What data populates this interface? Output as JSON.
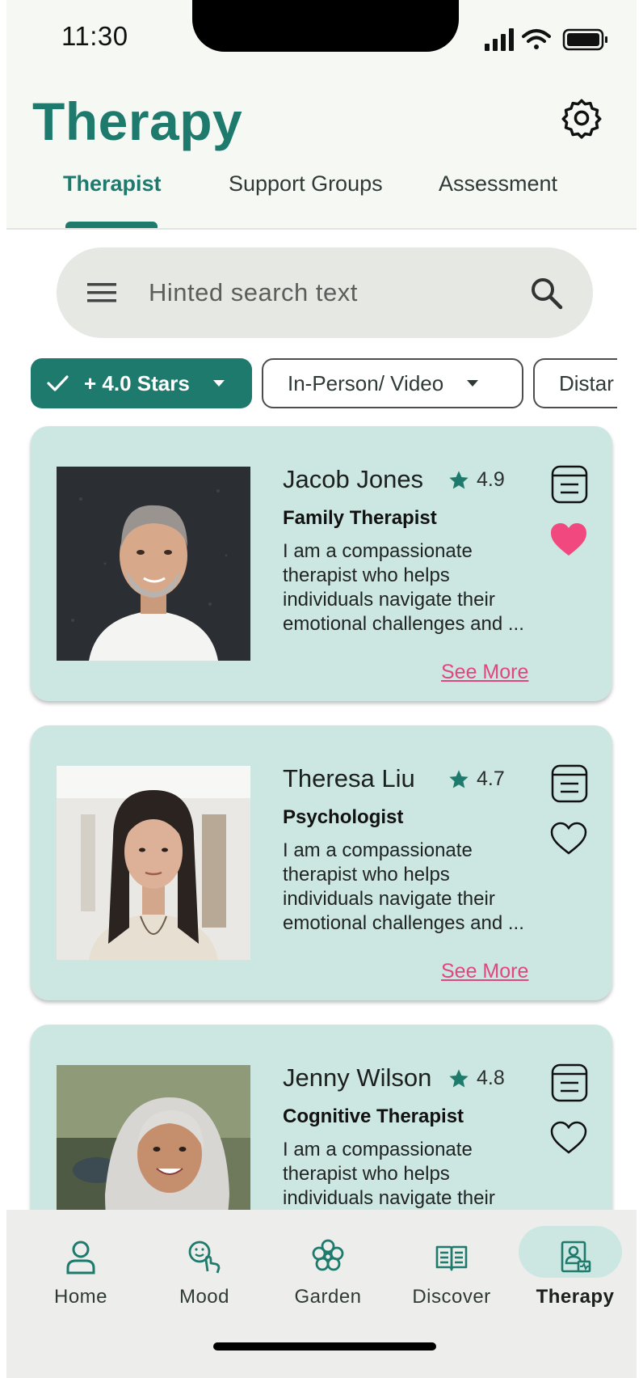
{
  "status": {
    "time": "11:30"
  },
  "header": {
    "title": "Therapy",
    "tabs": [
      {
        "label": "Therapist",
        "active": true
      },
      {
        "label": "Support Groups",
        "active": false
      },
      {
        "label": "Assessment",
        "active": false
      }
    ]
  },
  "search": {
    "placeholder": "Hinted search text"
  },
  "filters": [
    {
      "label": "+ 4.0 Stars",
      "selected": true
    },
    {
      "label": "In-Person/ Video",
      "selected": false
    },
    {
      "label": "Distar",
      "selected": false
    }
  ],
  "therapists": [
    {
      "name": "Jacob Jones",
      "rating": "4.9",
      "role": "Family Therapist",
      "desc_lines": [
        "I am a compassionate",
        "therapist who helps",
        "individuals navigate their",
        "emotional challenges and ..."
      ],
      "see_more": "See More",
      "favorited": true
    },
    {
      "name": "Theresa Liu",
      "rating": "4.7",
      "role": "Psychologist",
      "desc_lines": [
        "I am a compassionate",
        "therapist who helps",
        "individuals navigate their",
        "emotional challenges and ..."
      ],
      "see_more": "See More",
      "favorited": false
    },
    {
      "name": "Jenny Wilson",
      "rating": "4.8",
      "role": "Cognitive Therapist",
      "desc_lines": [
        "I am a compassionate",
        "therapist who helps",
        "individuals navigate their"
      ],
      "see_more": "",
      "favorited": false
    }
  ],
  "nav": [
    {
      "label": "Home",
      "icon": "person-icon",
      "active": false
    },
    {
      "label": "Mood",
      "icon": "mood-icon",
      "active": false
    },
    {
      "label": "Garden",
      "icon": "flower-icon",
      "active": false
    },
    {
      "label": "Discover",
      "icon": "book-icon",
      "active": false
    },
    {
      "label": "Therapy",
      "icon": "therapy-icon",
      "active": true
    }
  ],
  "colors": {
    "primary": "#1e7a6c",
    "card": "#cce7e2",
    "accent": "#f0487f",
    "header_bg": "#f6f8f4"
  }
}
